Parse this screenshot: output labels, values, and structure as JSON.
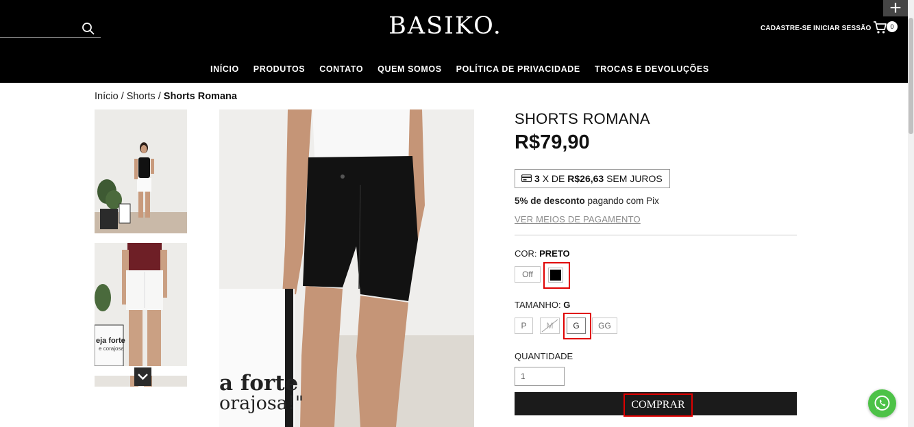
{
  "header": {
    "logo": "BASIKO.",
    "register_label": "CADASTRE-SE",
    "login_label": "INICIAR SESSÃO",
    "cart_count": "0",
    "plus_label": "+"
  },
  "nav": {
    "items": [
      "INÍCIO",
      "PRODUTOS",
      "CONTATO",
      "QUEM SOMOS",
      "POLÍTICA DE PRIVACIDADE",
      "TROCAS E DEVOLUÇÕES"
    ]
  },
  "breadcrumb": {
    "home": "Início",
    "category": "Shorts",
    "current": "Shorts Romana",
    "separator": "/"
  },
  "product": {
    "title": "SHORTS ROMANA",
    "price": "R$79,90",
    "installments": {
      "count": "3",
      "text_x_de": "X DE",
      "amount": "R$26,63",
      "suffix": "SEM JUROS"
    },
    "pix": {
      "bold": "5% de desconto",
      "rest": "pagando com Pix"
    },
    "payment_link": "VER MEIOS DE PAGAMENTO"
  },
  "options": {
    "color_label": "COR:",
    "color_selected": "PRETO",
    "color_off_label": "Off",
    "size_label": "TAMANHO:",
    "size_selected": "G",
    "sizes": [
      "P",
      "M",
      "G",
      "GG"
    ],
    "quantity_label": "QUANTIDADE",
    "quantity_value": "1"
  },
  "buy_button": "COMPRAR",
  "gallery": {
    "main_image_text_1": "a forte",
    "main_image_text_2": "orajosa!\"",
    "thumb2_text_1": "eja forte",
    "thumb2_text_2": "e corajosa"
  },
  "icons": {
    "search": "search-icon",
    "cart": "cart-icon",
    "card": "credit-card-icon",
    "chevron": "chevron-down-icon",
    "whatsapp": "whatsapp-icon"
  }
}
